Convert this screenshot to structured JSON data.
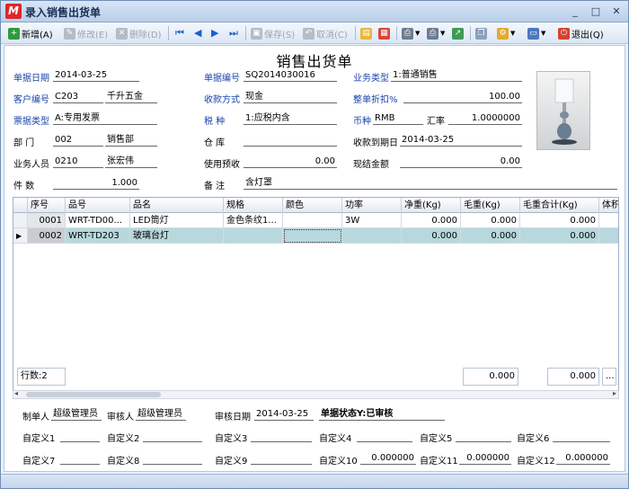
{
  "window": {
    "title": "录入销售出货单",
    "app_icon": "M"
  },
  "toolbar": {
    "new": "新增(A)",
    "edit": "修改(E)",
    "delete": "删除(D)",
    "save": "保存(S)",
    "cancel": "取消(C)",
    "exit": "退出(Q)"
  },
  "document": {
    "title": "销售出货单"
  },
  "form": {
    "date_label": "单据日期",
    "date_value": "2014-03-25",
    "docno_label": "单据编号",
    "docno_value": "SQ2014030016",
    "biztype_label": "业务类型",
    "biztype_value": "1:普通销售",
    "custno_label": "客户编号",
    "custno_value": "C203",
    "custname_value": "千升五金",
    "payway_label": "收款方式",
    "payway_value": "现金",
    "discount_label": "整单折扣%",
    "discount_value": "100.00",
    "invtype_label": "票据类型",
    "invtype_value": "A:专用发票",
    "tax_label": "税  种",
    "tax_value": "1:应税内含",
    "currency_label": "币种",
    "currency_value": "RMB",
    "rate_label": "汇率",
    "rate_value": "1.0000000",
    "dept_label": "部  门",
    "dept_code": "002",
    "dept_name": "销售部",
    "warehouse_label": "仓  库",
    "warehouse_value": "",
    "duedate_label": "收款到期日",
    "duedate_value": "2014-03-25",
    "staff_label": "业务人员",
    "staff_code": "0210",
    "staff_name": "张宏伟",
    "prepay_label": "使用预收",
    "prepay_value": "0.00",
    "settle_label": "现结金额",
    "settle_value": "0.00",
    "qty_label": "件  数",
    "qty_value": "1.000",
    "remark_label": "备  注",
    "remark_value": "含灯罩"
  },
  "grid": {
    "columns": [
      "序号",
      "品号",
      "品名",
      "规格",
      "颜色",
      "功率",
      "净重(Kg)",
      "毛重(Kg)",
      "毛重合计(Kg)",
      "体积"
    ],
    "rows": [
      [
        "0001",
        "WRT-TD00...",
        "LED筒灯",
        "金色条纹1...",
        "",
        "3W",
        "0.000",
        "0.000",
        "0.000"
      ],
      [
        "0002",
        "WRT-TD203",
        "玻璃台灯",
        "",
        "",
        "",
        "0.000",
        "0.000",
        "0.000"
      ]
    ],
    "row_count": "行数:2",
    "total1": "0.000",
    "total2": "0.000",
    "more": "..."
  },
  "footer": {
    "maker_label": "制单人",
    "maker_value": "超级管理员",
    "auditor_label": "审核人",
    "auditor_value": "超级管理员",
    "auditdate_label": "审核日期",
    "auditdate_value": "2014-03-25",
    "status": "单据状态Y:已审核",
    "custom": [
      "自定义1",
      "自定义2",
      "自定义3",
      "自定义4",
      "自定义5",
      "自定义6",
      "自定义7",
      "自定义8",
      "自定义9",
      "自定义10",
      "自定义11",
      "自定义12"
    ],
    "custom10_value": "0.000000",
    "custom11_value": "0.000000",
    "custom12_value": "0.000000"
  },
  "colors": {
    "label_blue": "#1b44a8",
    "selected_row": "#b7d8dc"
  }
}
